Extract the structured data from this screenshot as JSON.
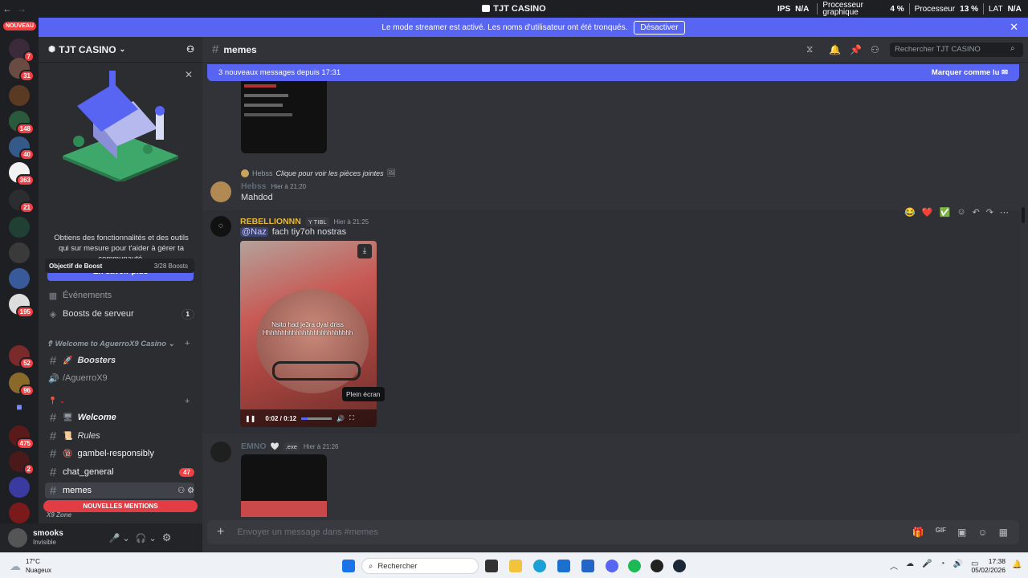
{
  "window": {
    "title": "TJT CASINO",
    "stats": {
      "ips_label": "IPS",
      "ips_value": "N/A",
      "gpu_label": "Processeur graphique",
      "gpu_value": "4 %",
      "cpu_label": "Processeur",
      "cpu_value": "13 %",
      "lat_label": "LAT",
      "lat_value": "N/A"
    }
  },
  "banner": {
    "text": "Le mode streamer est activé. Les noms d'utilisateur ont été tronqués.",
    "button": "Désactiver"
  },
  "rail": {
    "new_tag": "NOUVEAU",
    "badges": [
      "7",
      "31",
      "148",
      "40",
      "363",
      "21",
      "195",
      "52",
      "96",
      "475",
      "2"
    ]
  },
  "sidebar": {
    "server_name": "TJT CASINO",
    "promo_text": "Obtiens des fonctionnalités et des outils qui sur mesure pour t'aider à gérer ta communauté.",
    "promo_button": "En savoir plus",
    "boost_label": "Objectif de Boost",
    "boost_count": "3/28 Boosts",
    "events": "Événements",
    "server_boosts": "Boosts de serveur",
    "server_boosts_count": "1",
    "category1": "Welcome to AguerroX9 Casino",
    "boosters": "Boosters",
    "voice_channel": "/AguerroX9",
    "welcome": "Welcome",
    "rules": "Rules",
    "gamble": "gambel-responsibly",
    "chat_general": "chat_general",
    "chat_general_count": "47",
    "memes": "memes",
    "new_mentions": "NOUVELLES MENTIONS",
    "next_category": "X9 Zone"
  },
  "user": {
    "name": "smooks",
    "status": "Invisible"
  },
  "chat": {
    "channel": "memes",
    "search_placeholder": "Rechercher TJT CASINO",
    "new_messages": "3 nouveaux messages depuis 17:31",
    "mark_read": "Marquer comme lu",
    "messages": [
      {
        "reply_user": "Hebss",
        "reply_text": "Clique pour voir les pièces jointes",
        "author": "Hebss",
        "time": "Hier à 21:20",
        "text": "Mahdod"
      },
      {
        "author": "REBELLIONNN",
        "tag": "TIBL",
        "time": "Hier à 21:25",
        "mention": "@Naz",
        "text": "fach tiy7oh nostras",
        "video_caption": "Nsito had je3ra dyal driss Hhhhhhhhhhhhhhhhhhhhhhhhh",
        "video_time": "0:02 / 0:12",
        "tooltip": "Plein écran"
      },
      {
        "author": "EMNO",
        "tag": ".exe",
        "time": "Hier à 21:26"
      }
    ],
    "composer_placeholder": "Envoyer un message dans #memes"
  },
  "taskbar": {
    "weather_temp": "17°C",
    "weather_desc": "Nuageux",
    "search": "Rechercher",
    "time": "17:38",
    "date": "05/02/2026"
  }
}
